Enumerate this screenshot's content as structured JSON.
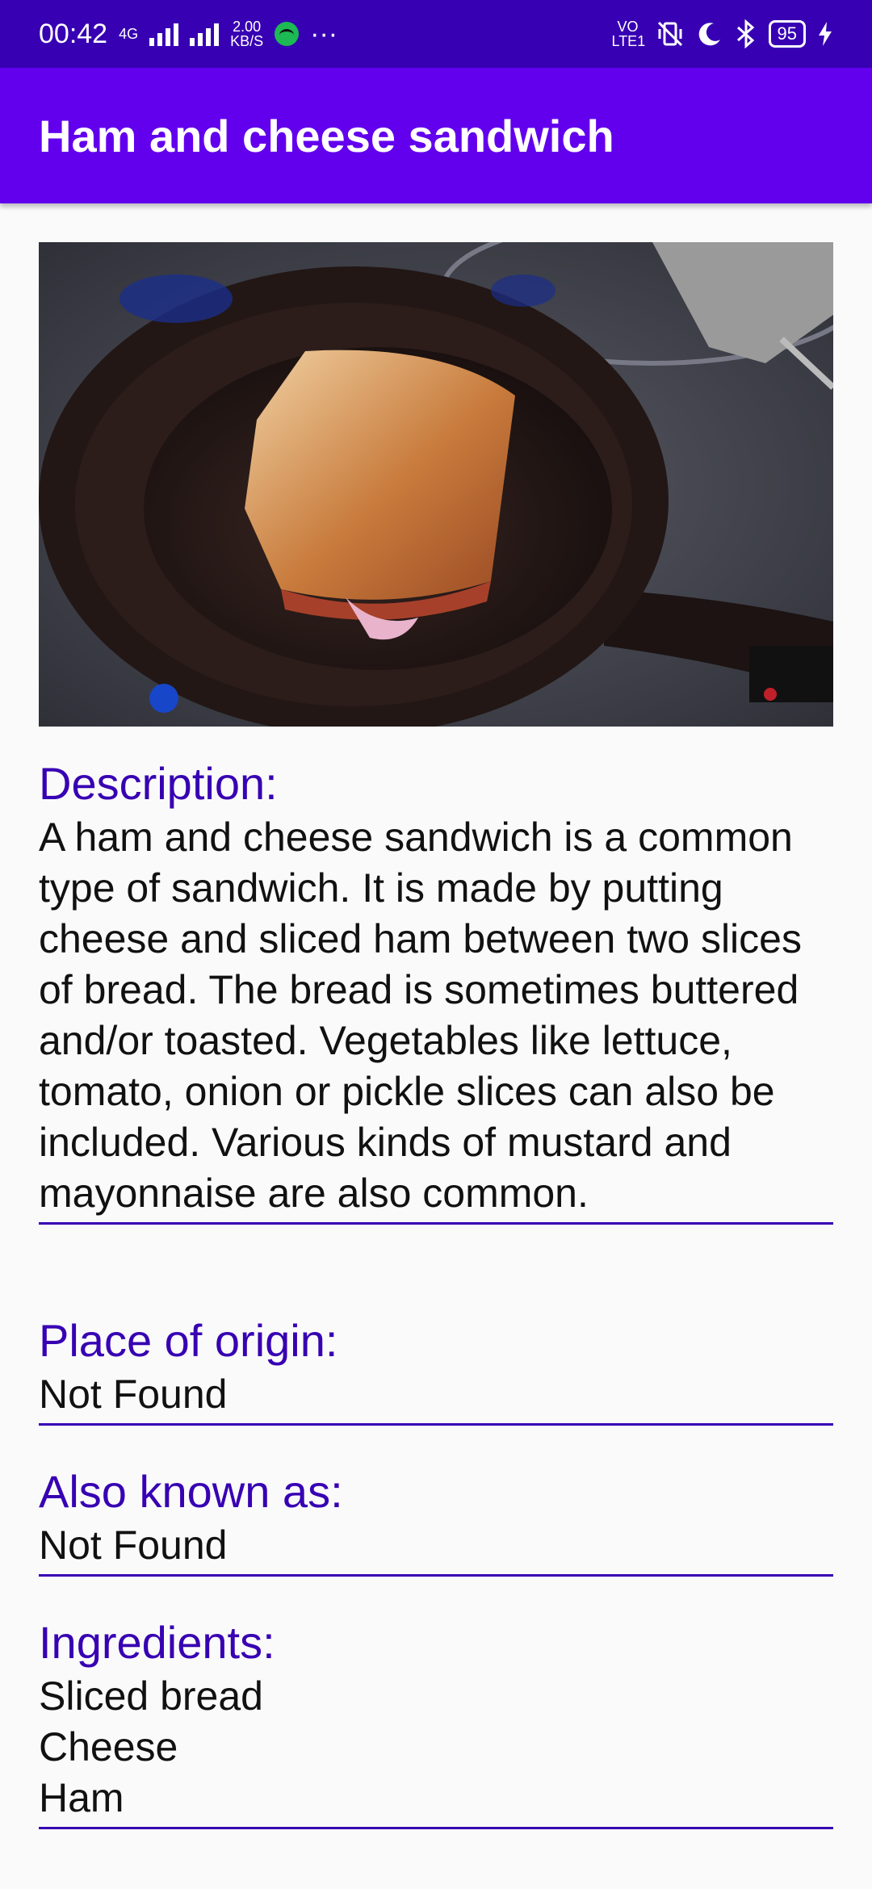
{
  "status_bar": {
    "time": "00:42",
    "network_type": "4G",
    "speed_value": "2.00",
    "speed_unit": "KB/S",
    "more": "···",
    "volte": "VO LTE1",
    "battery": "95"
  },
  "app_bar": {
    "title": "Ham and cheese sandwich"
  },
  "image": {
    "alt_subject": "sandwich-in-pan-photo"
  },
  "details": {
    "description_label": "Description:",
    "description_text": "A ham and cheese sandwich is a common type of sandwich. It is made by putting cheese and sliced ham between two slices of bread. The bread is sometimes buttered and/or toasted. Vegetables like lettuce, tomato, onion or pickle slices can also be included. Various kinds of mustard and mayonnaise are also common.",
    "origin_label": "Place of origin:",
    "origin_value": "Not Found",
    "aka_label": "Also known as:",
    "aka_value": "Not Found",
    "ingredients_label": "Ingredients:",
    "ingredients": [
      "Sliced bread",
      "Cheese",
      "Ham"
    ]
  },
  "colors": {
    "status_bar": "#3700b3",
    "app_bar": "#6200ee",
    "label": "#3700b3",
    "rule": "#3700b3"
  }
}
